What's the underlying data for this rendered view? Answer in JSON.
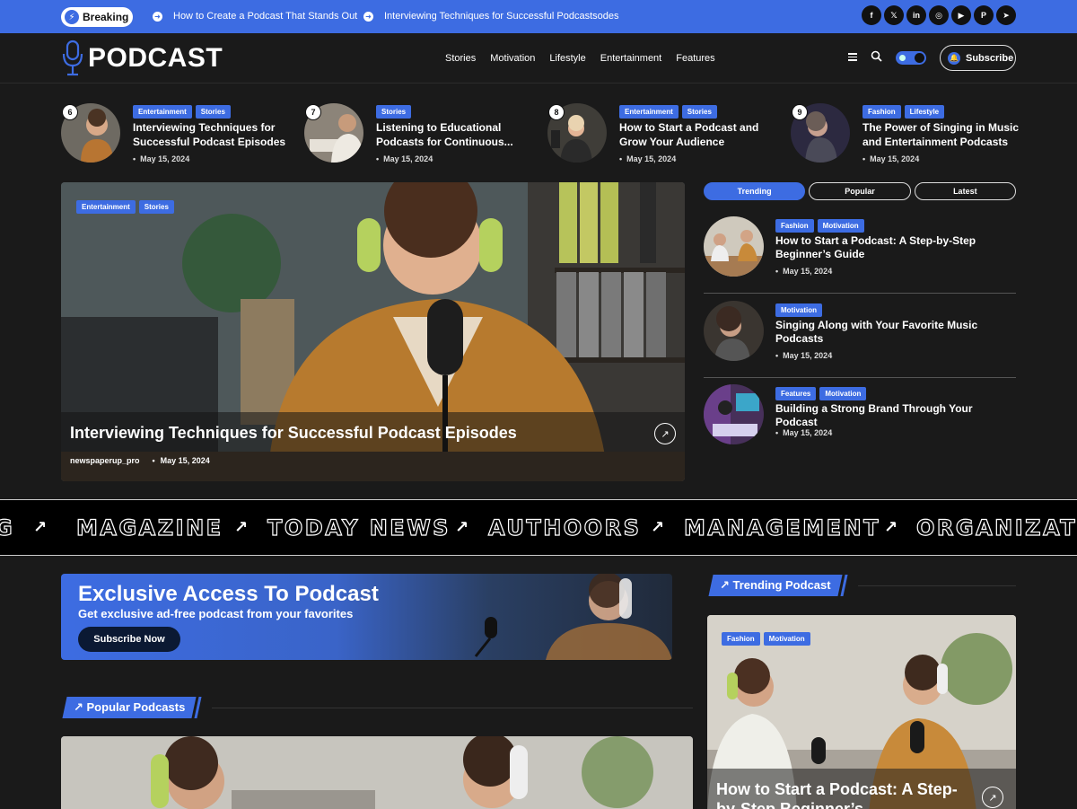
{
  "topbar": {
    "breaking_label": "Breaking",
    "ticker": [
      "How to Create a Podcast That Stands Out",
      "Interviewing Techniques for Successful Podcastsodes"
    ],
    "socials": [
      "facebook-icon",
      "x-icon",
      "linkedin-icon",
      "instagram-icon",
      "youtube-icon",
      "pinterest-icon",
      "telegram-icon"
    ]
  },
  "header": {
    "logo_text": "PODCAST",
    "nav": [
      "Stories",
      "Motivation",
      "Lifestyle",
      "Entertainment",
      "Features"
    ],
    "subscribe_label": "Subscribe"
  },
  "strip": [
    {
      "num": "6",
      "tags": [
        "Entertainment",
        "Stories"
      ],
      "title": "Interviewing Techniques for Successful Podcast Episodes",
      "date": "May 15, 2024"
    },
    {
      "num": "7",
      "tags": [
        "Stories"
      ],
      "title": "Listening to Educational Podcasts for Continuous...",
      "date": "May 15, 2024"
    },
    {
      "num": "8",
      "tags": [
        "Entertainment",
        "Stories"
      ],
      "title": "How to Start a Podcast and Grow Your Audience",
      "date": "May 15, 2024"
    },
    {
      "num": "9",
      "tags": [
        "Fashion",
        "Lifestyle"
      ],
      "title": "The Power of Singing in Music and Entertainment Podcasts",
      "date": "May 15, 2024"
    }
  ],
  "hero": {
    "tags": [
      "Entertainment",
      "Stories"
    ],
    "title": "Interviewing Techniques for Successful Podcast Episodes",
    "author": "newspaperup_pro",
    "date": "May 15, 2024"
  },
  "tabs": [
    "Trending",
    "Popular",
    "Latest"
  ],
  "side_list": [
    {
      "tags": [
        "Fashion",
        "Motivation"
      ],
      "title": "How to Start a Podcast: A Step-by-Step Beginner’s Guide",
      "date": "May 15, 2024"
    },
    {
      "tags": [
        "Motivation"
      ],
      "title": "Singing Along with Your Favorite Music Podcasts",
      "date": "May 15, 2024"
    },
    {
      "tags": [
        "Features",
        "Motivation"
      ],
      "title": "Building a Strong Brand Through Your Podcast",
      "date": "May 15, 2024"
    }
  ],
  "marquee": [
    "G",
    "MAGAZINE",
    "TODAY NEWS",
    "AUTHOORS",
    "MANAGEMENT",
    "ORGANIZATI"
  ],
  "banner": {
    "title": "Exclusive Access To Podcast",
    "subtitle": "Get exclusive ad-free podcast from your favorites",
    "button": "Subscribe Now"
  },
  "sections": {
    "trending": "Trending Podcast",
    "popular": "Popular Podcasts"
  },
  "trending_card": {
    "tags": [
      "Fashion",
      "Motivation"
    ],
    "title": "How to Start a Podcast: A Step-by-Step Beginner’s"
  },
  "colors": {
    "accent": "#3d6ce2",
    "background": "#1a1a1a"
  }
}
